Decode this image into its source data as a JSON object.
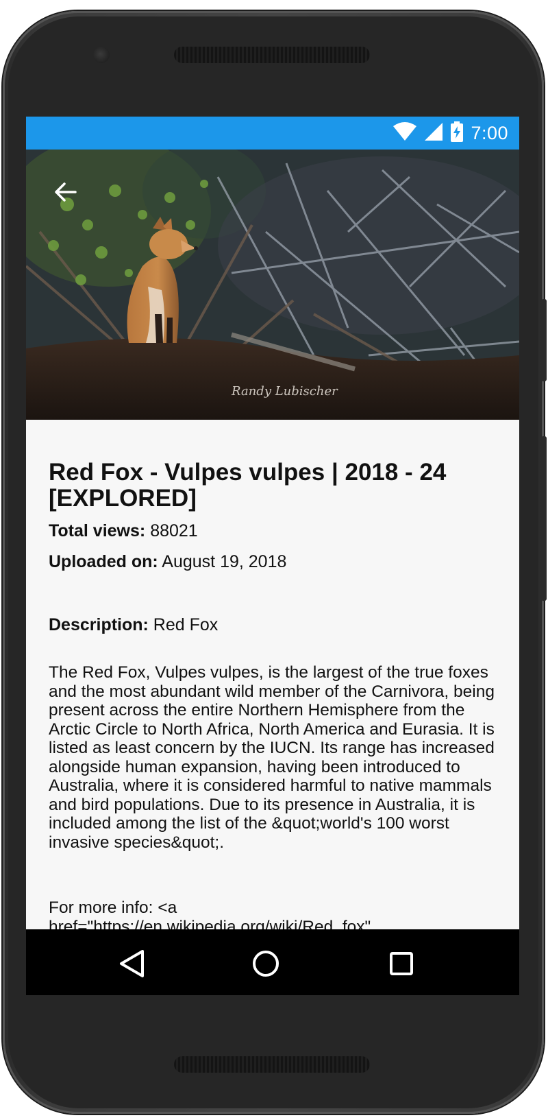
{
  "status_bar": {
    "time": "7:00",
    "icons": [
      "wifi-icon",
      "cell-signal-icon",
      "battery-charging-icon"
    ],
    "background": "#1c97ea"
  },
  "toolbar": {
    "back_icon": "arrow-back-icon"
  },
  "photo": {
    "subject": "red fox kit sitting among branches",
    "signature": "Randy Lubischer"
  },
  "details": {
    "title": "Red Fox - Vulpes vulpes | 2018 - 24 [EXPLORED]",
    "views_label": "Total views:",
    "views_value": " 88021",
    "uploaded_label": "Uploaded on:",
    "uploaded_value": " August 19, 2018",
    "description_label": "Description:",
    "description_value": " Red Fox",
    "description_body": "The Red Fox, Vulpes vulpes, is the largest of the true foxes and the most abundant wild member of the Carnivora, being present across the entire Northern Hemisphere from the Arctic Circle to North Africa, North America and Eurasia. It is listed as least concern by the IUCN. Its range has increased alongside human expansion, having been introduced to Australia, where it is considered harmful to native mammals and bird populations. Due to its presence in Australia, it is included among the list of the &quot;world's 100 worst invasive species&quot;.",
    "more_info": "For more info: <a href=\"https://en.wikipedia.org/wiki/Red_fox\" rel=\"nofollow\">en.wikipedia.org/wiki/Red_fox</a>"
  },
  "nav_bar": {
    "back_icon": "nav-back-triangle-icon",
    "home_icon": "nav-home-circle-icon",
    "recents_icon": "nav-recents-square-icon"
  }
}
